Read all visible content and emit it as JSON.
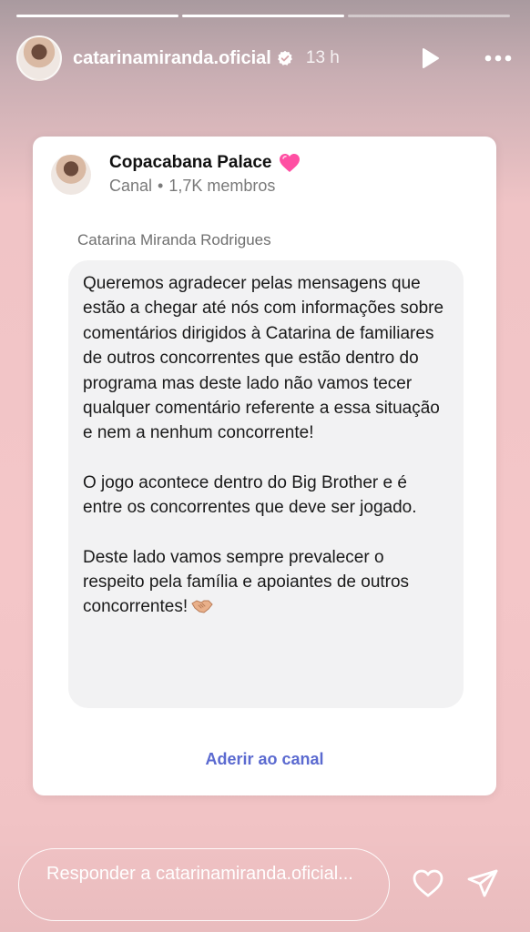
{
  "story": {
    "progress": {
      "segments": 3,
      "completed": 2
    },
    "username": "catarinamiranda.oficial",
    "time": "13 h",
    "icons": [
      "verified-icon",
      "play-icon",
      "more-icon"
    ]
  },
  "card": {
    "channel_name": "Copacabana Palace",
    "channel_emoji": "pink-heart-icon",
    "channel_type": "Canal",
    "separator": "•",
    "members": "1,7K membros",
    "sender": "Catarina Miranda Rodrigues",
    "message": {
      "paragraph1": "Queremos agradecer pelas mensagens que estão a chegar até nós com informações sobre comentários dirigidos à Catarina de familiares de outros concorrentes que estão dentro do programa mas deste lado não vamos tecer qualquer comentário referente a essa situação e nem a nenhum concorrente!",
      "paragraph2": "O jogo acontece dentro do Big Brother e é entre os concorrentes que deve ser jogado.",
      "paragraph3": "Deste lado vamos sempre prevalecer o respeito pela família e apoiantes de outros concorrentes!",
      "paragraph3_emoji": "handshake-icon"
    },
    "join_label": "Aderir ao canal"
  },
  "footer": {
    "reply_placeholder": "Responder a catarinamiranda.oficial...",
    "icons": [
      "heart-icon",
      "send-icon"
    ]
  },
  "colors": {
    "accent_link": "#5b6ad0",
    "verified_badge": "#ffffff",
    "emoji_heart": "#ff4fa3"
  }
}
